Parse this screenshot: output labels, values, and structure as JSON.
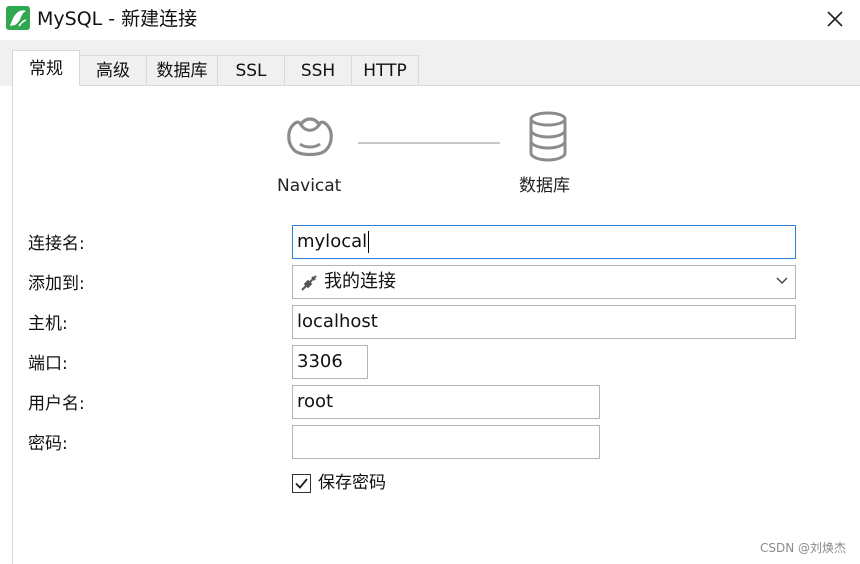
{
  "window": {
    "title": "MySQL - 新建连接",
    "app_icon": "mysql-dolphin-icon",
    "close_icon": "close-icon"
  },
  "tabs": [
    {
      "label": "常规",
      "active": true
    },
    {
      "label": "高级",
      "active": false
    },
    {
      "label": "数据库",
      "active": false
    },
    {
      "label": "SSL",
      "active": false
    },
    {
      "label": "SSH",
      "active": false
    },
    {
      "label": "HTTP",
      "active": false
    }
  ],
  "diagram": {
    "source_label": "Navicat",
    "target_label": "数据库",
    "source_icon": "navicat-icon",
    "target_icon": "database-icon"
  },
  "form": {
    "connection_name": {
      "label": "连接名:",
      "value": "mylocal"
    },
    "add_to": {
      "label": "添加到:",
      "value": "我的连接",
      "icon": "connection-plug-icon"
    },
    "host": {
      "label": "主机:",
      "value": "localhost"
    },
    "port": {
      "label": "端口:",
      "value": "3306"
    },
    "username": {
      "label": "用户名:",
      "value": "root"
    },
    "password": {
      "label": "密码:",
      "value": ""
    },
    "save_password": {
      "label": "保存密码",
      "checked": true
    }
  },
  "watermark": "CSDN @刘焕杰",
  "colors": {
    "accent_focus": "#2f7fd4",
    "app_icon_green": "#2fa84f",
    "icon_gray": "#8c8c8c",
    "tab_bar_bg": "#f0f0f0"
  }
}
